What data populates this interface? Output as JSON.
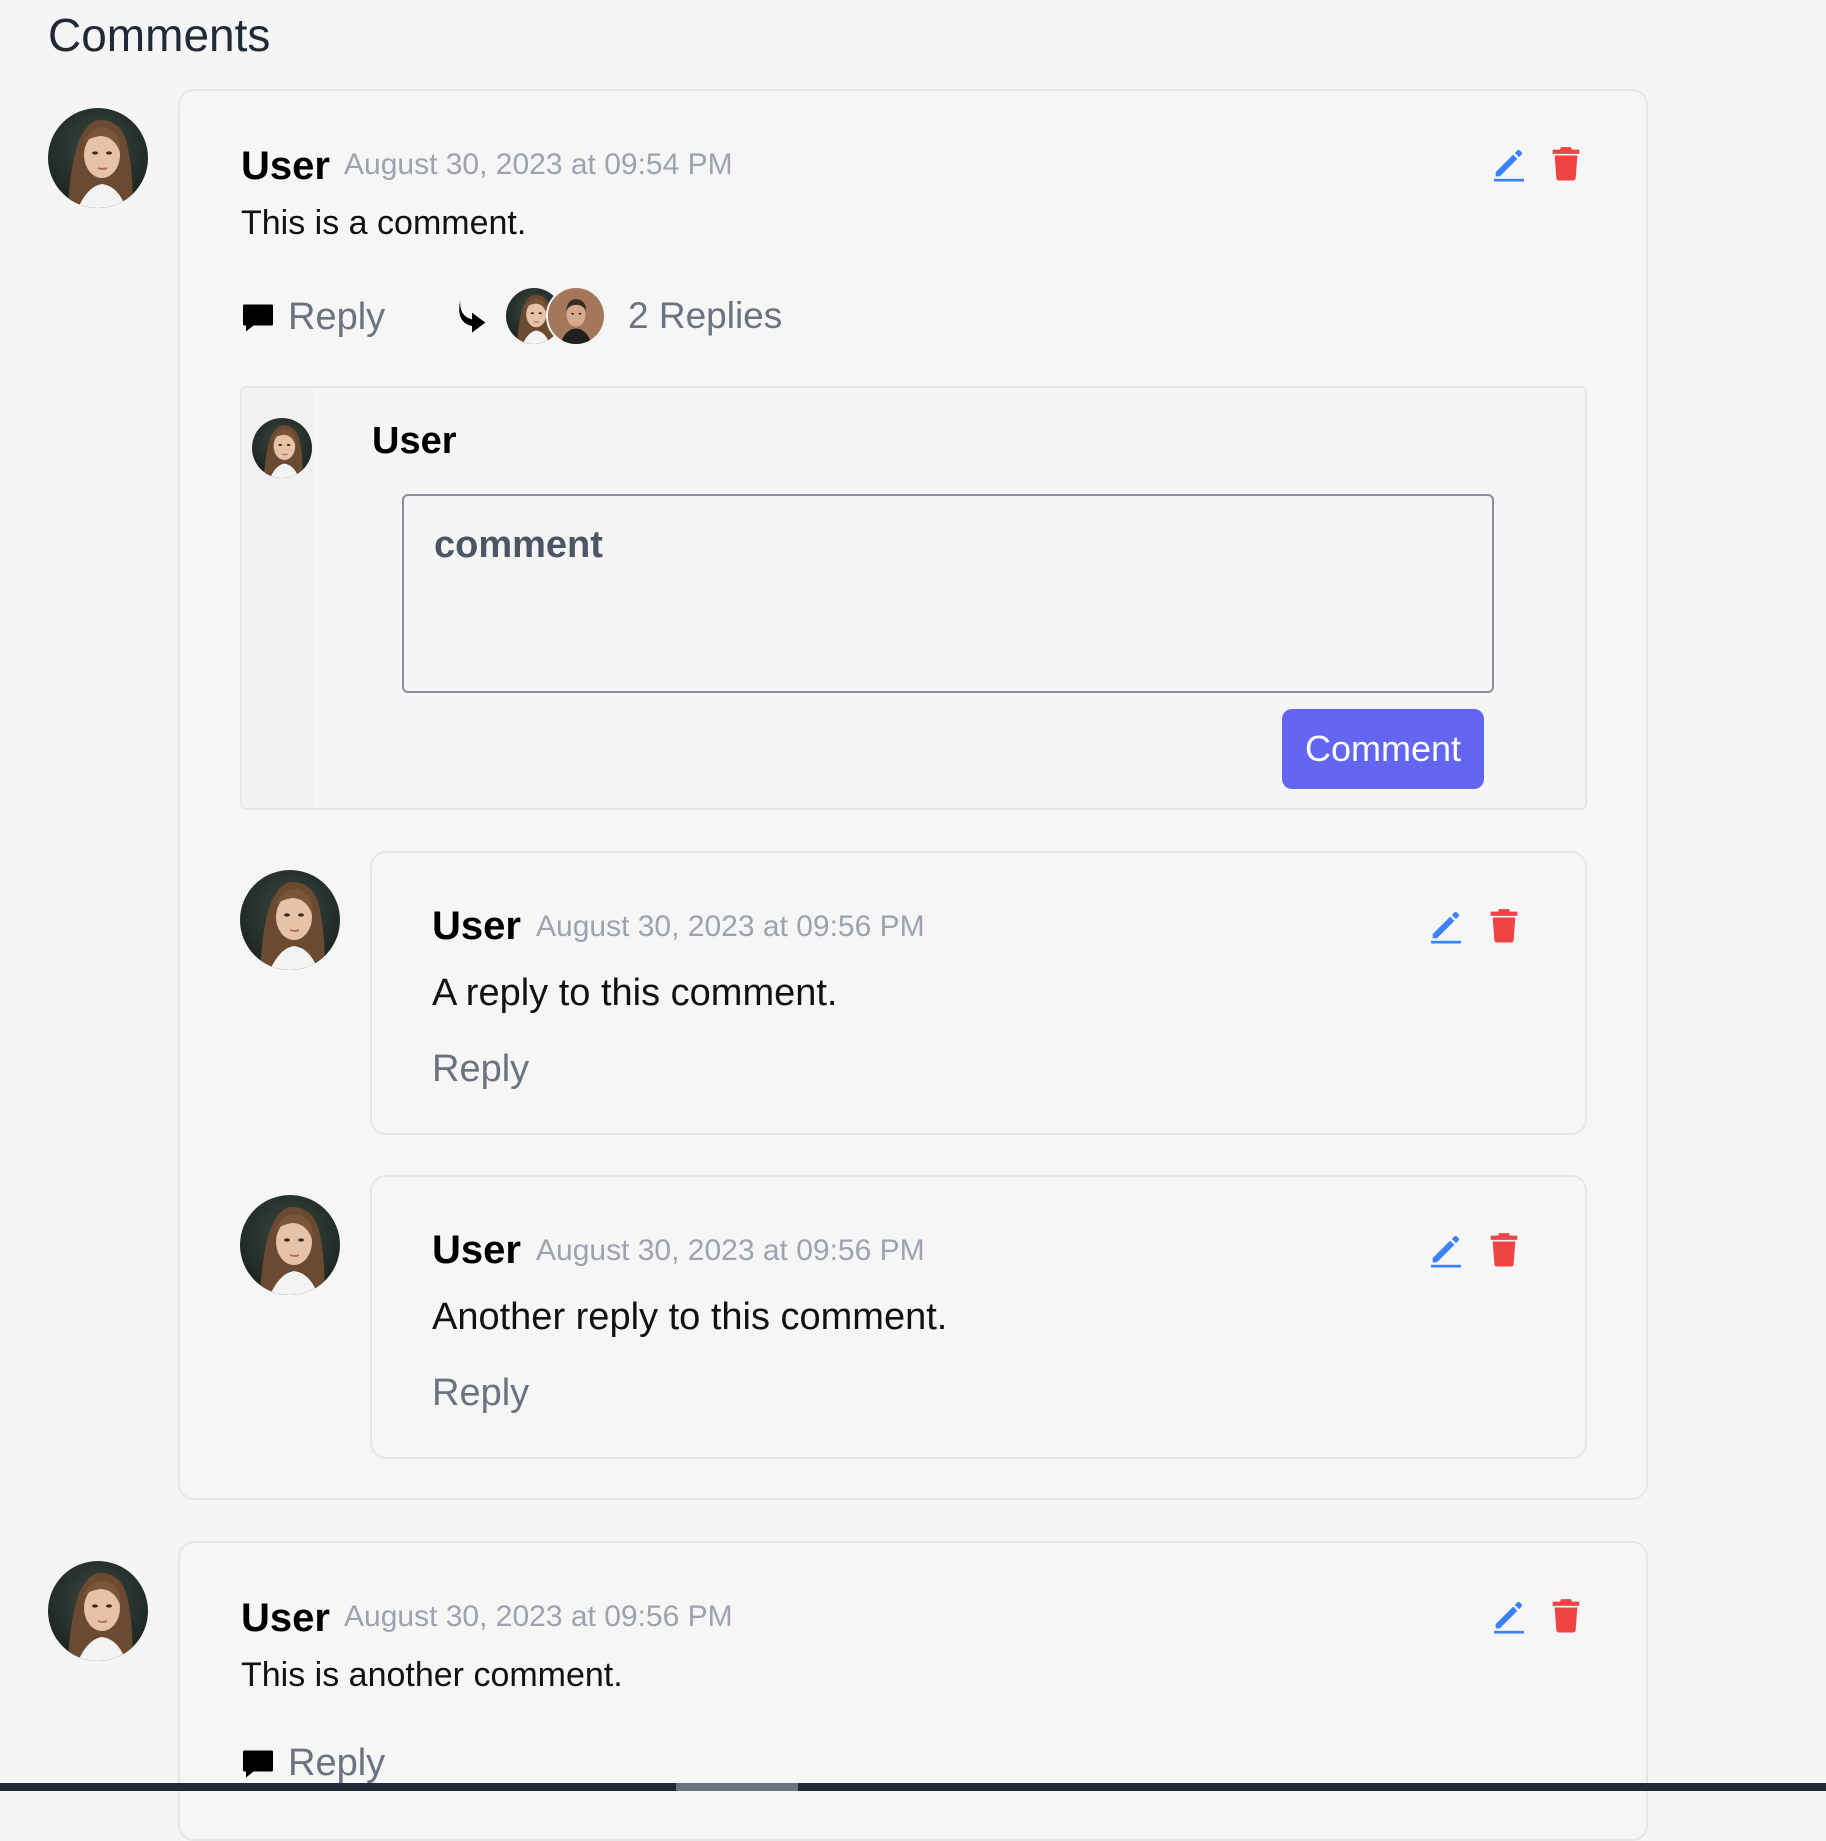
{
  "page": {
    "title": "Comments"
  },
  "colors": {
    "accent": "#6366f1",
    "edit": "#3b82f6",
    "delete": "#ef4444",
    "muted": "#6b7280",
    "timestamp": "#9ca3af"
  },
  "comments": [
    {
      "author": "User",
      "timestamp": "August 30, 2023 at 09:54 PM",
      "body": "This is a comment.",
      "reply_label": "Reply",
      "replies_count_label": "2 Replies",
      "reply_form": {
        "author": "User",
        "placeholder": "comment",
        "submit_label": "Comment"
      },
      "replies": [
        {
          "author": "User",
          "timestamp": "August 30, 2023 at 09:56 PM",
          "body": "A reply to this comment.",
          "reply_label": "Reply"
        },
        {
          "author": "User",
          "timestamp": "August 30, 2023 at 09:56 PM",
          "body": "Another reply to this comment.",
          "reply_label": "Reply"
        }
      ]
    },
    {
      "author": "User",
      "timestamp": "August 30, 2023 at 09:56 PM",
      "body": "This is another comment.",
      "reply_label": "Reply"
    }
  ],
  "icons": {
    "edit": "pencil-icon",
    "delete": "trash-icon",
    "reply": "speech-bubble-icon",
    "replies": "curved-arrow-icon",
    "avatar": "user-avatar"
  }
}
